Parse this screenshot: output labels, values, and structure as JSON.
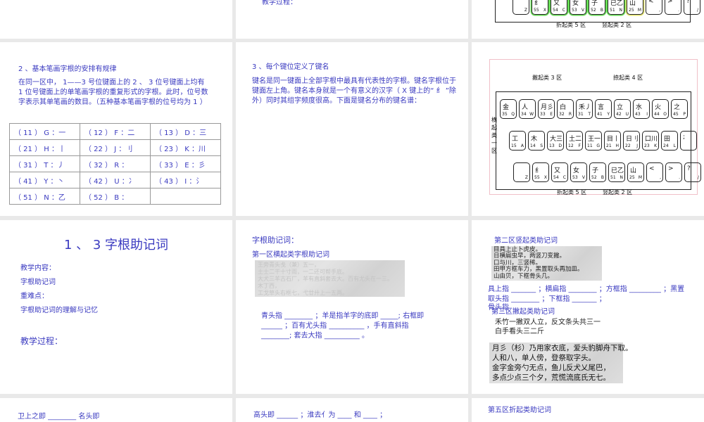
{
  "slides": {
    "s_top2": {
      "text": "教学过程："
    },
    "s_21": {
      "title": "2 、基本笔画字根的安排有规律",
      "body": "在同一区中， 1——3 号位键面上的 2 、 3 位号键面上均有 1 位号键面上的单笔画字根的重复形式的字根。此时，位号数字表示其单笔画的数目。（五种基本笔画字根的位号均为 1 ）",
      "table": [
        [
          "（ 11 ） G ：一",
          "（ 12 ） F ：二",
          "（ 13 ） D ：三"
        ],
        [
          "（ 21 ） H ：丨",
          "（ 22 ） J ：刂",
          "（ 23 ） K ：川"
        ],
        [
          "（ 31 ） T ：丿",
          "（ 32 ） R ：",
          "（ 33 ） E ：彡"
        ],
        [
          "（ 41 ） Y ：丶",
          "（ 42 ） U ：冫",
          "（ 43 ） I ：氵"
        ],
        [
          "（ 51 ） N ：乙",
          "（ 52 ） B ：",
          ""
        ]
      ]
    },
    "s_22": {
      "title": "3 、每个键位定义了键名",
      "body": "键名是同一键面上全部字根中最具有代表性的字根。键名字根位于键面左上角。键名本身就是一个有意义的汉字（ X 键上的“ 纟 ”除外）同时其组字频度很高。下面是键名分布的键名谱："
    },
    "keyboard": {
      "zone_labels": [
        "撇起类 3 区",
        "捺起类 4 区",
        "横起类一区",
        "折起类 5 区",
        "竖起类 2 区"
      ],
      "rows": [
        [
          [
            "金",
            "35",
            "Q"
          ],
          [
            "人",
            "34",
            "W"
          ],
          [
            "月彡",
            "33",
            "E"
          ],
          [
            "白",
            "32",
            "R"
          ],
          [
            "禾丿",
            "31",
            "T"
          ],
          [
            "言",
            "41",
            "Y"
          ],
          [
            "立",
            "42",
            "U"
          ],
          [
            "水",
            "43",
            "I"
          ],
          [
            "火",
            "44",
            "O"
          ],
          [
            "之",
            "45",
            "P"
          ]
        ],
        [
          [
            "工",
            "15",
            "A"
          ],
          [
            "木",
            "14",
            "S"
          ],
          [
            "大三",
            "13",
            "D"
          ],
          [
            "土二",
            "12",
            "F"
          ],
          [
            "王一",
            "11",
            "G"
          ],
          [
            "目丨",
            "21",
            "H"
          ],
          [
            "日刂",
            "22",
            "J"
          ],
          [
            "口川",
            "23",
            "K"
          ],
          [
            "田",
            "24",
            "L"
          ],
          [
            ";",
            "",
            ""
          ]
        ],
        [
          [
            "",
            "",
            "Z"
          ],
          [
            "纟",
            "55",
            "X"
          ],
          [
            "又",
            "54",
            "C"
          ],
          [
            "女",
            "53",
            "V"
          ],
          [
            "子",
            "52",
            "B"
          ],
          [
            "已乙",
            "51",
            "N"
          ],
          [
            "山",
            "25",
            "M"
          ],
          [
            "<",
            "",
            ","
          ],
          [
            ">",
            "",
            "."
          ],
          [
            "?",
            "",
            "/"
          ]
        ]
      ]
    },
    "s_31": {
      "title": "1 、 3 字根助记词",
      "items": [
        "教学内容：",
        "字根助记词",
        "重难点：",
        "字根助记词的理解与记忆"
      ],
      "process": "教学过程："
    },
    "s_32": {
      "title": "字根助记词：",
      "subtitle": "第一区横起类字根助记词",
      "faded": [
        "王旁青头戋（兼）五一，",
        "土士二干十寸雨，一二还可帮手底。",
        "大犬三羊古石厂，羊有直斜套去大。百有尤头在一三。",
        "木丁西，　　　　",
        "工戈草头右框七，弋廿廾上一五两。"
      ],
      "fill": "青头指 ________ ；羊是指羊字的底即 _____; 右框即 ______ ；百有尤头指 __________ ，手有直斜指 ________; 套去大指 __________ 。"
    },
    "s_33": {
      "title": "第二区竖起类助记词",
      "box1": [
        "目具上止卜虎皮。",
        "日横扁虫早，两竖刀变撇。",
        "口与川，三竖稀。",
        "田甲方框车力，黑置取头再加皿。",
        "山由贝，下框骨头几。"
      ],
      "fill": "具上指 _______ ；横扁指 ________ ；方框指 _________ ；黑置取头指 ________ ；下框指 _______ ；",
      "fill_tail": "骨头指",
      "title3": "第三区撇起类助记词",
      "lines": [
        "禾竹一撇双人立，反文条头共三一",
        "白手看头三二斤"
      ],
      "box2": [
        "月彡（杉）乃用家衣底，爱头豹脚舟下取。",
        "人和八，单人傍，登祭取字头。",
        "金字金旁勺无点，鱼儿反犬乂尾巴，",
        "多点少点三个夕，荒慌流底氏无七。"
      ]
    },
    "s_41": {
      "text": "卫上之即 ________ 名头即"
    },
    "s_42": {
      "text": "高头即 ______ ；淮去亻为 ____ 和 ____ ；"
    },
    "s_43": {
      "text": "第五区折起类助记词"
    }
  },
  "colors": {
    "text": "#3a3ac0",
    "highlight_green": "#66dd55",
    "highlight_yellow": "#e8e870"
  }
}
